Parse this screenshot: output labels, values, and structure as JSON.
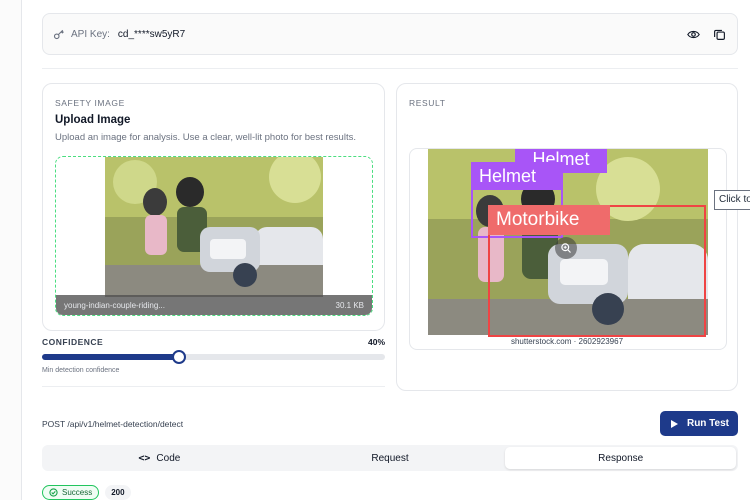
{
  "api": {
    "label": "API Key:",
    "value": "cd_****sw5yR7"
  },
  "upload": {
    "section_label": "SAFETY IMAGE",
    "title": "Upload Image",
    "description": "Upload an image for analysis. Use a clear, well-lit photo for best results.",
    "file_name": "young-indian-couple-riding...",
    "file_size": "30.1 KB"
  },
  "confidence": {
    "label": "CONFIDENCE",
    "value_text": "40%",
    "value": 0.4,
    "hint": "Min detection confidence"
  },
  "result": {
    "section_label": "RESULT",
    "watermark": "shutterstock.com · 2602923967",
    "labels": [
      "Helmet",
      "Helmet",
      "Motorbike"
    ],
    "tooltip": "Click to"
  },
  "request": {
    "endpoint": "POST /api/v1/helmet-detection/detect",
    "run_label": "Run Test"
  },
  "tabs": [
    {
      "label": "Code",
      "active": false
    },
    {
      "label": "Request",
      "active": false
    },
    {
      "label": "Response",
      "active": true
    }
  ],
  "status": {
    "text": "Success",
    "code": "200"
  },
  "colors": {
    "primary": "#1e3a8a",
    "success": "#22c55e",
    "helmet_box": "#a855f7",
    "motorbike_box": "#ef4444"
  },
  "icons": [
    "key-icon",
    "eye-icon",
    "copy-icon",
    "zoom-icon",
    "play-icon",
    "code-icon",
    "check-circle-icon"
  ]
}
